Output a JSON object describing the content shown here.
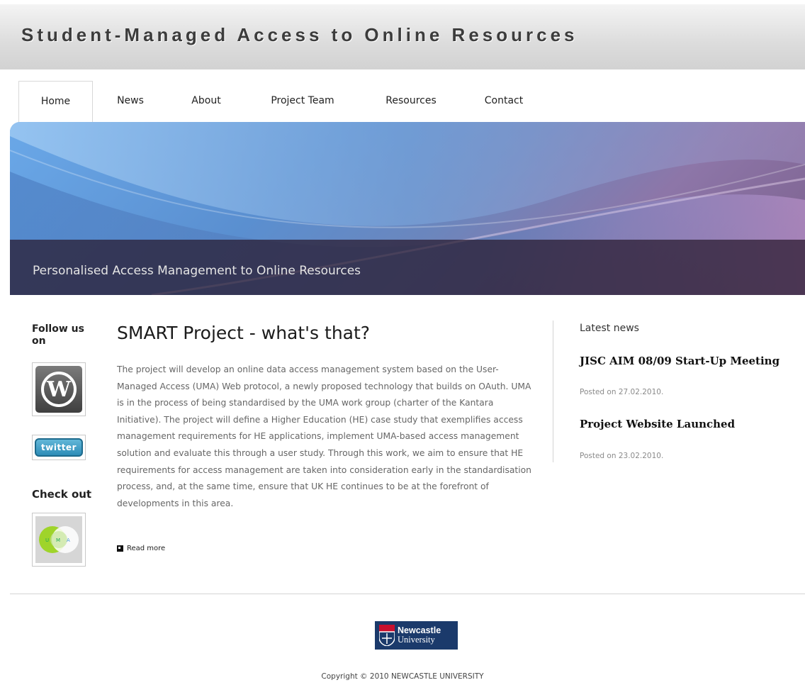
{
  "header": {
    "title": "Student-Managed Access to Online Resources"
  },
  "nav": {
    "items": [
      {
        "label": "Home",
        "active": true
      },
      {
        "label": "News"
      },
      {
        "label": "About"
      },
      {
        "label": "Project Team"
      },
      {
        "label": "Resources"
      },
      {
        "label": "Contact"
      }
    ]
  },
  "banner": {
    "caption": "Personalised Access Management to Online Resources"
  },
  "sidebar": {
    "follow_title": "Follow us on",
    "wordpress_glyph": "W",
    "twitter_label": "twitter",
    "check_title": "Check out",
    "uma_letters": [
      "U",
      "M",
      "A"
    ]
  },
  "article": {
    "title": "SMART Project - what's that?",
    "body": "The project will develop an online data access management system based on the User-Managed Access (UMA) Web protocol, a newly proposed technology that builds on OAuth. UMA is in the process of being standardised by the UMA work group (charter of the Kantara Initiative). The project will define a Higher Education (HE) case study that exemplifies access management requirements for HE applications, implement UMA-based access management solution and evaluate this through a user study. Through this work, we aim to ensure that HE requirements for access management are taken into consideration early in the standardisation process, and, at the same time, ensure that UK HE continues to be at the forefront of developments in this area.",
    "read_more": "Read more"
  },
  "latest_news": {
    "heading": "Latest news",
    "items": [
      {
        "title": "JISC AIM 08/09 Start-Up Meeting",
        "date": "Posted on 27.02.2010."
      },
      {
        "title": "Project Website Launched",
        "date": "Posted on 23.02.2010."
      }
    ]
  },
  "footer": {
    "logo_line1": "Newcastle",
    "logo_line2": "University",
    "copyright": "Copyright © 2010 NEWCASTLE UNIVERSITY"
  },
  "colors": {
    "nav_text": "#222222",
    "logo_blue": "#1b3a6b",
    "caption_text": "#e4e4e4"
  }
}
